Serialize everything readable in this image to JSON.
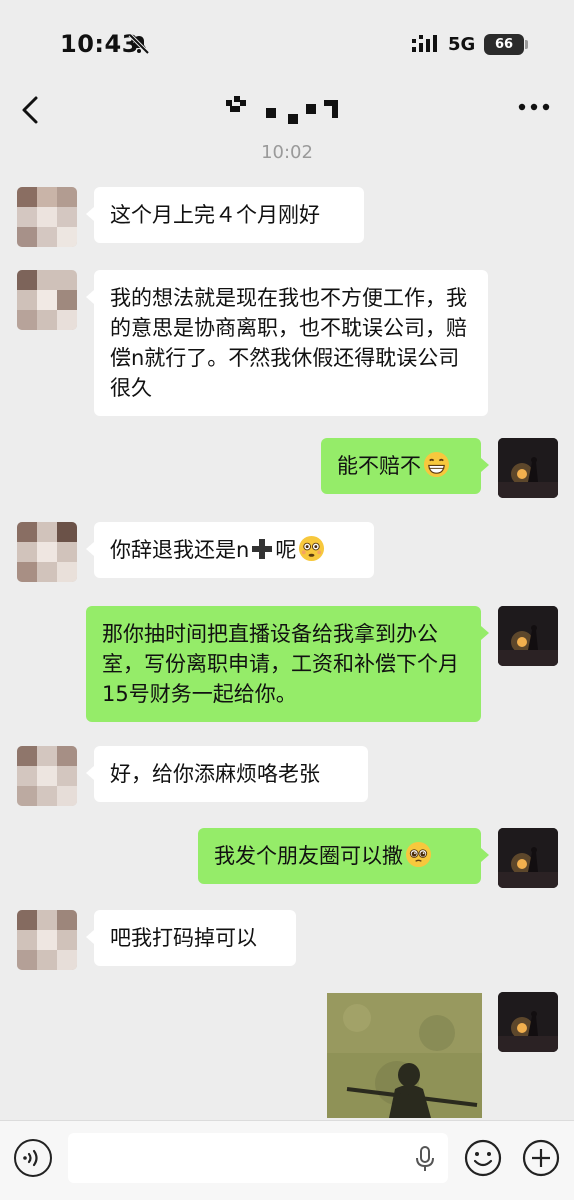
{
  "status": {
    "time": "10:43",
    "network": "5G",
    "battery": "66"
  },
  "header": {
    "back_icon": "chevron-left-icon",
    "title": "",
    "more_icon": "more-dots-icon"
  },
  "timestamp": "10:02",
  "messages": [
    {
      "side": "in",
      "text": "这个月上完４个月刚好"
    },
    {
      "side": "in",
      "text": "我的想法就是现在我也不方便工作，我的意思是协商离职，也不耽误公司，赔偿n就行了。不然我休假还得耽误公司很久"
    },
    {
      "side": "out",
      "text": "能不赔不",
      "emoji": "grinning-face-icon"
    },
    {
      "side": "in",
      "text_before": "你辞退我还是n",
      "emoji_mid": "plus-icon",
      "text_after": "呢",
      "emoji": "flushed-face-icon"
    },
    {
      "side": "out",
      "text": "那你抽时间把直播设备给我拿到办公室，写份离职申请，工资和补偿下个月15号财务一起给你。"
    },
    {
      "side": "in",
      "text": "好，给你添麻烦咯老张"
    },
    {
      "side": "out",
      "text": "我发个朋友圈可以撒",
      "emoji": "pleading-face-icon"
    },
    {
      "side": "in",
      "text": "吧我打码掉可以"
    },
    {
      "side": "out",
      "type": "image",
      "alt": "shadow-photo"
    }
  ],
  "input": {
    "placeholder": "",
    "voice_icon": "voice-icon",
    "emoji_icon": "emoji-icon",
    "plus_icon": "plus-circle-icon"
  },
  "colors": {
    "background": "#ededed",
    "outgoing_bubble": "#95ec69",
    "incoming_bubble": "#ffffff"
  }
}
